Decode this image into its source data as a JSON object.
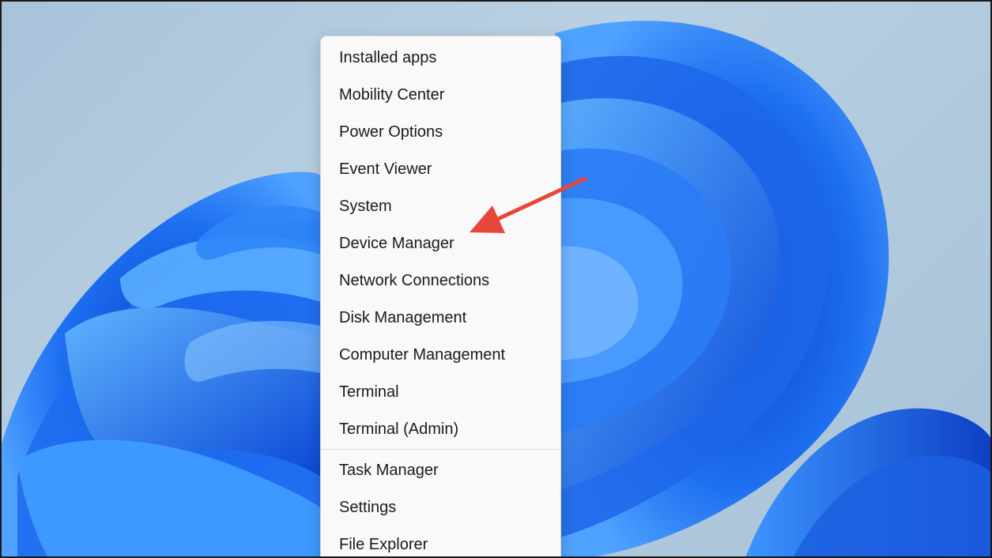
{
  "colors": {
    "menu_background": "#f9f9f9",
    "menu_text": "#1b1b1b",
    "annotation_arrow": "#e8463a",
    "wallpaper_bloom": "#1a6cf0",
    "wallpaper_sky": "#b9d0e2"
  },
  "context_menu": {
    "items": [
      {
        "label": "Installed apps"
      },
      {
        "label": "Mobility Center"
      },
      {
        "label": "Power Options"
      },
      {
        "label": "Event Viewer"
      },
      {
        "label": "System"
      },
      {
        "label": "Device Manager"
      },
      {
        "label": "Network Connections"
      },
      {
        "label": "Disk Management"
      },
      {
        "label": "Computer Management"
      },
      {
        "label": "Terminal"
      },
      {
        "label": "Terminal (Admin)"
      },
      {
        "label": "Task Manager"
      },
      {
        "label": "Settings"
      },
      {
        "label": "File Explorer"
      }
    ]
  },
  "annotation": {
    "arrow_icon": "red-arrow-icon",
    "points_to": "Device Manager"
  }
}
